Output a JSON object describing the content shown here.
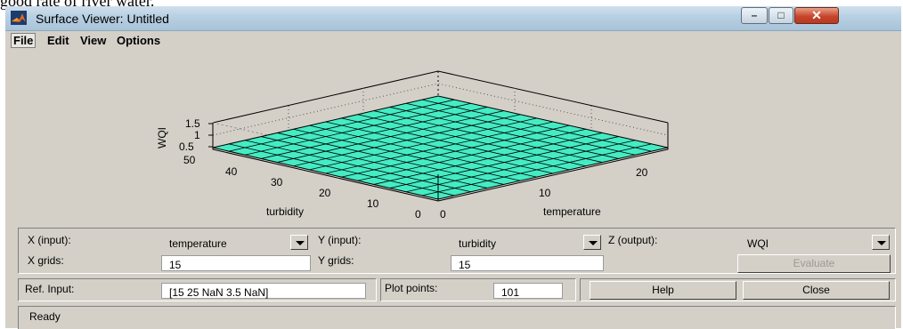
{
  "page_caption": "good rate of river water.",
  "window": {
    "title": "Surface Viewer: Untitled"
  },
  "title_controls": {
    "minimize": "–",
    "maximize": "□",
    "close": "✕"
  },
  "menu": [
    {
      "label": "File"
    },
    {
      "label": "Edit"
    },
    {
      "label": "View"
    },
    {
      "label": "Options"
    }
  ],
  "plot": {
    "surface_color": "#44ecc4",
    "z_axis_label": "WQI",
    "z_ticks": [
      "1.5",
      "1",
      "0.5"
    ],
    "y_axis_label": "turbidity",
    "y_ticks": [
      "50",
      "40",
      "30",
      "20",
      "10",
      "0"
    ],
    "x_axis_label": "temperature",
    "x_ticks": [
      "0",
      "10",
      "20"
    ]
  },
  "controls": {
    "x_input_label": "X (input):",
    "x_input_value": "temperature",
    "y_input_label": "Y (input):",
    "y_input_value": "turbidity",
    "z_output_label": "Z (output):",
    "z_output_value": "WQI",
    "x_grids_label": "X grids:",
    "x_grids_value": "15",
    "y_grids_label": "Y grids:",
    "y_grids_value": "15",
    "evaluate_label": "Evaluate",
    "ref_input_label": "Ref. Input:",
    "ref_input_value": "[15 25 NaN 3.5 NaN]",
    "plot_points_label": "Plot points:",
    "plot_points_value": "101",
    "help_label": "Help",
    "close_label": "Close"
  },
  "status": {
    "text": "Ready"
  }
}
